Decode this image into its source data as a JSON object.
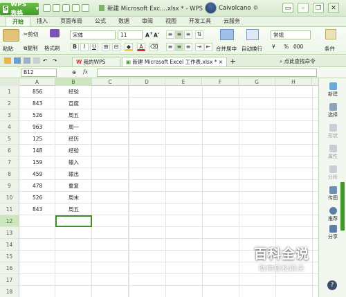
{
  "titlebar": {
    "app_label": "WPS 表格",
    "window_title": "新建 Microsoft Exc....xlsx * - WPS 表格",
    "user_name": "Caivolcano"
  },
  "ribbon_tabs": [
    "开始",
    "插入",
    "页面布局",
    "公式",
    "数据",
    "审阅",
    "视图",
    "开发工具",
    "云服务"
  ],
  "ribbon": {
    "paste": "粘贴",
    "cut": "剪切",
    "copy": "复制",
    "format_painter": "格式刷",
    "font_name": "宋体",
    "font_size": "11",
    "merge_center": "合并居中",
    "wrap_text": "自动换行",
    "number_format": "常规",
    "conditional": "条件",
    "percent": "%",
    "comma": "000",
    "currency": "¥"
  },
  "doc_tabs": {
    "tab1": "我的WPS",
    "tab2": "新建 Microsoft Excel 工作表.xlsx *",
    "help": "点此查找命令"
  },
  "formula_bar": {
    "name_box": "B12",
    "fx": "fx",
    "content": ""
  },
  "sheet": {
    "columns": [
      "A",
      "B",
      "C",
      "D",
      "E",
      "F",
      "G",
      "H"
    ],
    "rows": [
      "1",
      "2",
      "3",
      "4",
      "5",
      "6",
      "7",
      "8",
      "9",
      "10",
      "11",
      "12",
      "13",
      "14",
      "15",
      "16",
      "17",
      "18"
    ],
    "col_a": [
      "856",
      "843",
      "526",
      "963",
      "125",
      "148",
      "159",
      "459",
      "478",
      "526",
      "843"
    ],
    "col_b": [
      "经验",
      "百度",
      "周五",
      "周一",
      "经历",
      "经验",
      "输入",
      "输出",
      "重复",
      "周末",
      "周五"
    ]
  },
  "right_pane": [
    "新建",
    "选择",
    "形状",
    "属性",
    "分析",
    "传图",
    "推荐",
    "分享"
  ],
  "watermark": {
    "title": "百科全说",
    "subtitle": "助你轻松解决"
  },
  "colors": {
    "accent": "#3f9a28",
    "selection": "#3d8c27"
  }
}
